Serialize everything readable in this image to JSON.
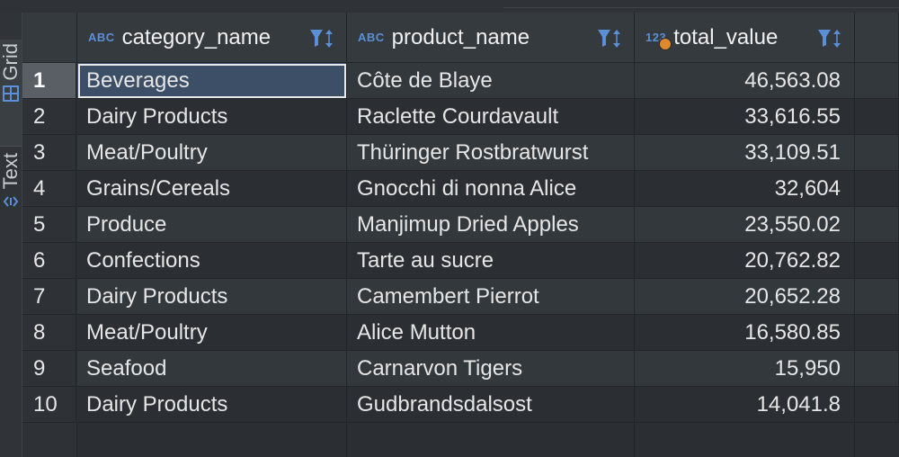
{
  "sidebar": {
    "tabs": [
      {
        "label": "Grid",
        "icon": "grid-icon"
      },
      {
        "label": "Text",
        "icon": "text-icon"
      }
    ]
  },
  "columns": [
    {
      "type_badge": "ABC",
      "name": "category_name"
    },
    {
      "type_badge": "ABC",
      "name": "product_name"
    },
    {
      "type_badge": "123",
      "name": "total_value"
    }
  ],
  "rows": [
    {
      "num": "1",
      "category_name": "Beverages",
      "product_name": "Côte de Blaye",
      "total_value": "46,563.08"
    },
    {
      "num": "2",
      "category_name": "Dairy Products",
      "product_name": "Raclette Courdavault",
      "total_value": "33,616.55"
    },
    {
      "num": "3",
      "category_name": "Meat/Poultry",
      "product_name": "Thüringer Rostbratwurst",
      "total_value": "33,109.51"
    },
    {
      "num": "4",
      "category_name": "Grains/Cereals",
      "product_name": "Gnocchi di nonna Alice",
      "total_value": "32,604"
    },
    {
      "num": "5",
      "category_name": "Produce",
      "product_name": "Manjimup Dried Apples",
      "total_value": "23,550.02"
    },
    {
      "num": "6",
      "category_name": "Confections",
      "product_name": "Tarte au sucre",
      "total_value": "20,762.82"
    },
    {
      "num": "7",
      "category_name": "Dairy Products",
      "product_name": "Camembert Pierrot",
      "total_value": "20,652.28"
    },
    {
      "num": "8",
      "category_name": "Meat/Poultry",
      "product_name": "Alice Mutton",
      "total_value": "16,580.85"
    },
    {
      "num": "9",
      "category_name": "Seafood",
      "product_name": "Carnarvon Tigers",
      "total_value": "15,950"
    },
    {
      "num": "10",
      "category_name": "Dairy Products",
      "product_name": "Gudbrandsdalsost",
      "total_value": "14,041.8"
    }
  ],
  "colors": {
    "accent": "#5b8fd6",
    "selection_bg": "#3d4f66",
    "numeric_badge_dot": "#e08a2e"
  }
}
